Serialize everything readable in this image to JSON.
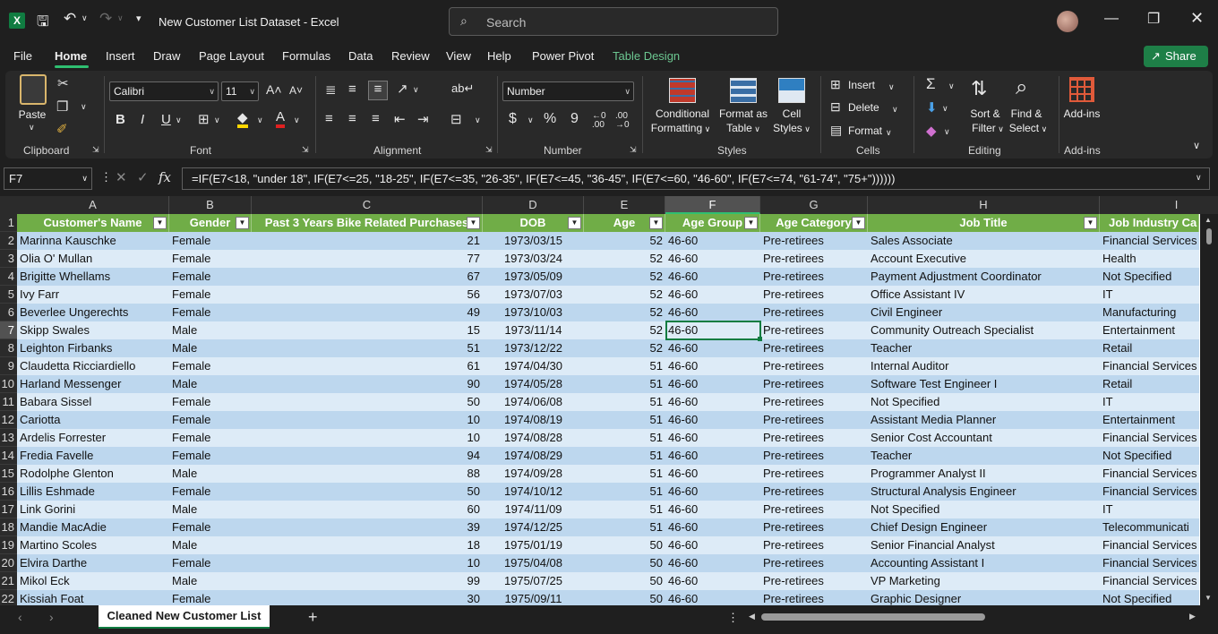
{
  "titlebar": {
    "app_icon": "X",
    "title": "New Customer List Dataset  -  Excel",
    "search_placeholder": "Search"
  },
  "menu": {
    "items": [
      "File",
      "Home",
      "Insert",
      "Draw",
      "Page Layout",
      "Formulas",
      "Data",
      "Review",
      "View",
      "Help",
      "Power Pivot",
      "Table Design"
    ],
    "active": "Home",
    "share": "Share"
  },
  "ribbon": {
    "clipboard": {
      "paste": "Paste",
      "label": "Clipboard"
    },
    "font": {
      "name": "Calibri",
      "size": "11",
      "label": "Font",
      "bold": "B",
      "italic": "I",
      "underline": "U"
    },
    "alignment": {
      "label": "Alignment"
    },
    "number": {
      "format": "Number",
      "label": "Number",
      "currency": "$",
      "percent": "%",
      "comma": "9",
      "inc_dec": "←0 .00",
      "dec_dec": ".00 →0"
    },
    "styles": {
      "cond_format_1": "Conditional",
      "cond_format_2": "Formatting",
      "format_table_1": "Format as",
      "format_table_2": "Table",
      "cell_styles_1": "Cell",
      "cell_styles_2": "Styles",
      "label": "Styles"
    },
    "cells": {
      "insert": "Insert",
      "delete": "Delete",
      "format": "Format",
      "label": "Cells"
    },
    "editing": {
      "sort_1": "Sort &",
      "sort_2": "Filter",
      "find_1": "Find &",
      "find_2": "Select",
      "label": "Editing"
    },
    "addins": {
      "button": "Add-ins",
      "label": "Add-ins"
    }
  },
  "formula_bar": {
    "name_box": "F7",
    "formula": "=IF(E7<18, \"under 18\", IF(E7<=25, \"18-25\", IF(E7<=35, \"26-35\", IF(E7<=45, \"36-45\", IF(E7<=60, \"46-60\", IF(E7<=74, \"61-74\", \"75+\"))))))"
  },
  "sheet": {
    "column_letters": [
      "A",
      "B",
      "C",
      "D",
      "E",
      "F",
      "G",
      "H",
      "I"
    ],
    "headers": [
      "Customer's Name",
      "Gender",
      "Past 3 Years Bike Related Purchases",
      "DOB",
      "Age",
      "Age Group",
      "Age Category",
      "Job Title",
      "Job Industry Ca"
    ],
    "row_numbers": [
      "1",
      "2",
      "3",
      "4",
      "5",
      "6",
      "7",
      "8",
      "9",
      "10",
      "11",
      "12",
      "13",
      "14",
      "15",
      "16",
      "17",
      "18",
      "19",
      "20",
      "21",
      "22"
    ],
    "rows": [
      [
        "Marinna Kauschke",
        "Female",
        "21",
        "1973/03/15",
        "52",
        "46-60",
        "Pre-retirees",
        "Sales Associate",
        "Financial Services"
      ],
      [
        "Olia O' Mullan",
        "Female",
        "77",
        "1973/03/24",
        "52",
        "46-60",
        "Pre-retirees",
        "Account Executive",
        "Health"
      ],
      [
        "Brigitte Whellams",
        "Female",
        "67",
        "1973/05/09",
        "52",
        "46-60",
        "Pre-retirees",
        "Payment Adjustment Coordinator",
        "Not Specified"
      ],
      [
        "Ivy Farr",
        "Female",
        "56",
        "1973/07/03",
        "52",
        "46-60",
        "Pre-retirees",
        "Office Assistant IV",
        "IT"
      ],
      [
        "Beverlee Ungerechts",
        "Female",
        "49",
        "1973/10/03",
        "52",
        "46-60",
        "Pre-retirees",
        "Civil Engineer",
        "Manufacturing"
      ],
      [
        "Skipp Swales",
        "Male",
        "15",
        "1973/11/14",
        "52",
        "46-60",
        "Pre-retirees",
        "Community Outreach Specialist",
        "Entertainment"
      ],
      [
        "Leighton Firbanks",
        "Male",
        "51",
        "1973/12/22",
        "52",
        "46-60",
        "Pre-retirees",
        "Teacher",
        "Retail"
      ],
      [
        "Claudetta Ricciardiello",
        "Female",
        "61",
        "1974/04/30",
        "51",
        "46-60",
        "Pre-retirees",
        "Internal Auditor",
        "Financial Services"
      ],
      [
        "Harland Messenger",
        "Male",
        "90",
        "1974/05/28",
        "51",
        "46-60",
        "Pre-retirees",
        "Software Test Engineer I",
        "Retail"
      ],
      [
        "Babara Sissel",
        "Female",
        "50",
        "1974/06/08",
        "51",
        "46-60",
        "Pre-retirees",
        "Not Specified",
        "IT"
      ],
      [
        "Cariotta",
        "Female",
        "10",
        "1974/08/19",
        "51",
        "46-60",
        "Pre-retirees",
        "Assistant Media Planner",
        "Entertainment"
      ],
      [
        "Ardelis Forrester",
        "Female",
        "10",
        "1974/08/28",
        "51",
        "46-60",
        "Pre-retirees",
        "Senior Cost Accountant",
        "Financial Services"
      ],
      [
        "Fredia Favelle",
        "Female",
        "94",
        "1974/08/29",
        "51",
        "46-60",
        "Pre-retirees",
        "Teacher",
        "Not Specified"
      ],
      [
        "Rodolphe Glenton",
        "Male",
        "88",
        "1974/09/28",
        "51",
        "46-60",
        "Pre-retirees",
        "Programmer Analyst II",
        "Financial Services"
      ],
      [
        "Lillis Eshmade",
        "Female",
        "50",
        "1974/10/12",
        "51",
        "46-60",
        "Pre-retirees",
        "Structural Analysis Engineer",
        "Financial Services"
      ],
      [
        "Link Gorini",
        "Male",
        "60",
        "1974/11/09",
        "51",
        "46-60",
        "Pre-retirees",
        "Not Specified",
        "IT"
      ],
      [
        "Mandie MacAdie",
        "Female",
        "39",
        "1974/12/25",
        "51",
        "46-60",
        "Pre-retirees",
        "Chief Design Engineer",
        "Telecommunicati"
      ],
      [
        "Martino Scoles",
        "Male",
        "18",
        "1975/01/19",
        "50",
        "46-60",
        "Pre-retirees",
        "Senior Financial Analyst",
        "Financial Services"
      ],
      [
        "Elvira Darthe",
        "Female",
        "10",
        "1975/04/08",
        "50",
        "46-60",
        "Pre-retirees",
        "Accounting Assistant I",
        "Financial Services"
      ],
      [
        "Mikol Eck",
        "Male",
        "99",
        "1975/07/25",
        "50",
        "46-60",
        "Pre-retirees",
        "VP Marketing",
        "Financial Services"
      ],
      [
        "Kissiah Foat",
        "Female",
        "30",
        "1975/09/11",
        "50",
        "46-60",
        "Pre-retirees",
        "Graphic Designer",
        "Not Specified"
      ]
    ]
  },
  "sheet_tabs": {
    "active": "Cleaned New Customer List",
    "add": "+"
  },
  "colors": {
    "accent": "#107c41",
    "table_header": "#70ad47",
    "band_light": "#ddebf7",
    "band_dark": "#bdd7ee"
  }
}
